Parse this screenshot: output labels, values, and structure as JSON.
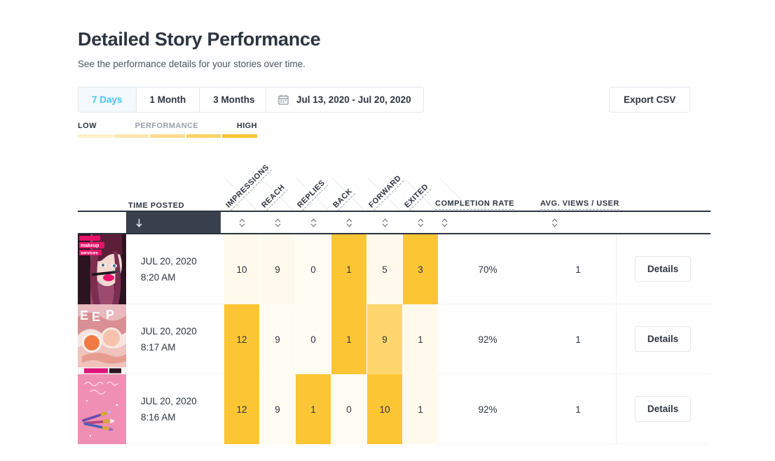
{
  "header": {
    "title": "Detailed Story Performance",
    "subtitle": "See the performance details for your stories over time."
  },
  "controls": {
    "ranges": [
      {
        "label": "7 Days",
        "active": true
      },
      {
        "label": "1 Month",
        "active": false
      },
      {
        "label": "3 Months",
        "active": false
      }
    ],
    "date_range": "Jul 13, 2020 - Jul 20, 2020",
    "calendar_icon": "calendar-icon",
    "export_label": "Export CSV"
  },
  "legend": {
    "low": "LOW",
    "middle": "PERFORMANCE",
    "high": "HIGH",
    "colors": [
      "#fdefc8",
      "#fde7ab",
      "#fcdd8a",
      "#fbd263",
      "#f9c333"
    ]
  },
  "table": {
    "time_header": "TIME POSTED",
    "rotated_headers": [
      "IMPRESSIONS",
      "REACH",
      "REPLIES",
      "BACK",
      "FORWARD",
      "EXITED"
    ],
    "flat_headers": [
      "COMPLETION RATE",
      "AVG. VIEWS / USER"
    ],
    "sort_active_icon": "arrow-down-icon",
    "sort_icon": "sort-updown-icon",
    "details_label": "Details",
    "rows": [
      {
        "thumbnail": "makeup-services-model-thumbnail",
        "date": "JUL 20, 2020",
        "time": "8:20 AM",
        "metrics": [
          {
            "value": "10",
            "color": "#fffaec"
          },
          {
            "value": "9",
            "color": "#fffaec"
          },
          {
            "value": "0",
            "color": "#fffcf3"
          },
          {
            "value": "1",
            "color": "#fcc534"
          },
          {
            "value": "5",
            "color": "#fffaec"
          },
          {
            "value": "3",
            "color": "#fcc534"
          }
        ],
        "completion_rate": "70%",
        "avg_views_per_user": "1"
      },
      {
        "thumbnail": "eep-orange-makeup-thumbnail",
        "date": "JUL 20, 2020",
        "time": "8:17 AM",
        "metrics": [
          {
            "value": "12",
            "color": "#fcc534"
          },
          {
            "value": "9",
            "color": "#fffcf3"
          },
          {
            "value": "0",
            "color": "#fffcf3"
          },
          {
            "value": "1",
            "color": "#fcc534"
          },
          {
            "value": "9",
            "color": "#fdd76e"
          },
          {
            "value": "1",
            "color": "#fffaec"
          }
        ],
        "completion_rate": "92%",
        "avg_views_per_user": "1"
      },
      {
        "thumbnail": "pink-makeup-brushes-thumbnail",
        "date": "JUL 20, 2020",
        "time": "8:16 AM",
        "metrics": [
          {
            "value": "12",
            "color": "#fcc534"
          },
          {
            "value": "9",
            "color": "#fffcf3"
          },
          {
            "value": "1",
            "color": "#fcc534"
          },
          {
            "value": "0",
            "color": "#fffcf3"
          },
          {
            "value": "10",
            "color": "#fcc534"
          },
          {
            "value": "1",
            "color": "#fffaec"
          }
        ],
        "completion_rate": "92%",
        "avg_views_per_user": "1"
      }
    ]
  }
}
